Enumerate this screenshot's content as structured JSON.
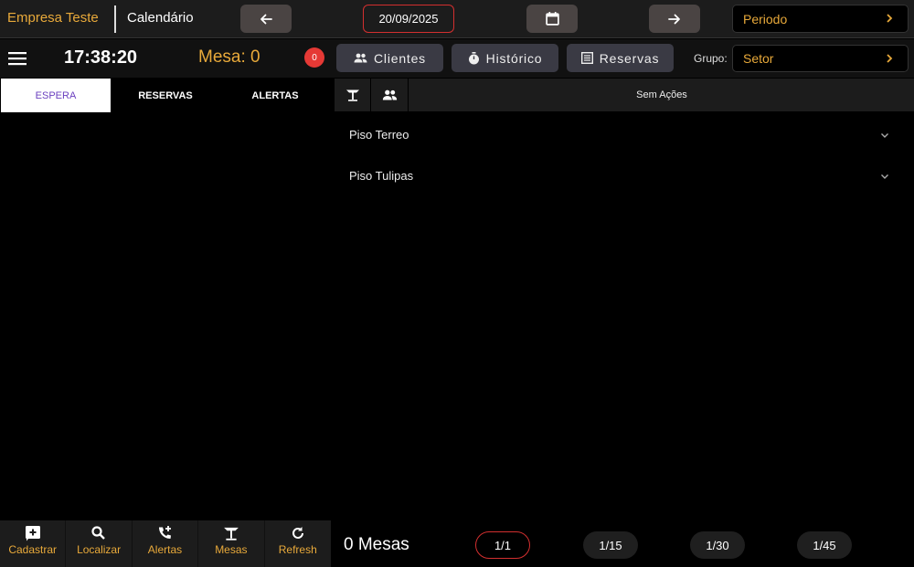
{
  "header": {
    "brand": "Empresa Teste",
    "title": "Calendário",
    "date": "20/09/2025",
    "periodo_label": "Periodo"
  },
  "toolbar": {
    "clock": "17:38:20",
    "mesa": "Mesa: 0",
    "badge_count": "0",
    "clientes_label": "Clientes",
    "historico_label": "Histórico",
    "reservas_label": "Reservas",
    "grupo_label": "Grupo:",
    "setor_value": "Setor"
  },
  "tabs": [
    {
      "label": "ESPERA",
      "active": true
    },
    {
      "label": "RESERVAS",
      "active": false
    },
    {
      "label": "ALERTAS",
      "active": false
    }
  ],
  "right_toolbar": {
    "icons": [
      "table-icon",
      "people-icon"
    ],
    "status": "Sem Ações"
  },
  "floors": [
    {
      "name": "Piso Terreo"
    },
    {
      "name": "Piso Tulipas"
    }
  ],
  "actions": [
    {
      "label": "Cadastrar",
      "icon": "add-box-icon"
    },
    {
      "label": "Localizar",
      "icon": "search-icon"
    },
    {
      "label": "Alertas",
      "icon": "phone-add-icon"
    },
    {
      "label": "Mesas",
      "icon": "table-icon"
    },
    {
      "label": "Refresh",
      "icon": "refresh-icon"
    }
  ],
  "footer": {
    "mesas_count": "0 Mesas",
    "pages": [
      "1/1",
      "1/15",
      "1/30",
      "1/45"
    ]
  },
  "colors": {
    "accent": "#e8a93a",
    "alert": "#d32f2f",
    "active_tab_text": "#6a3fbf"
  }
}
